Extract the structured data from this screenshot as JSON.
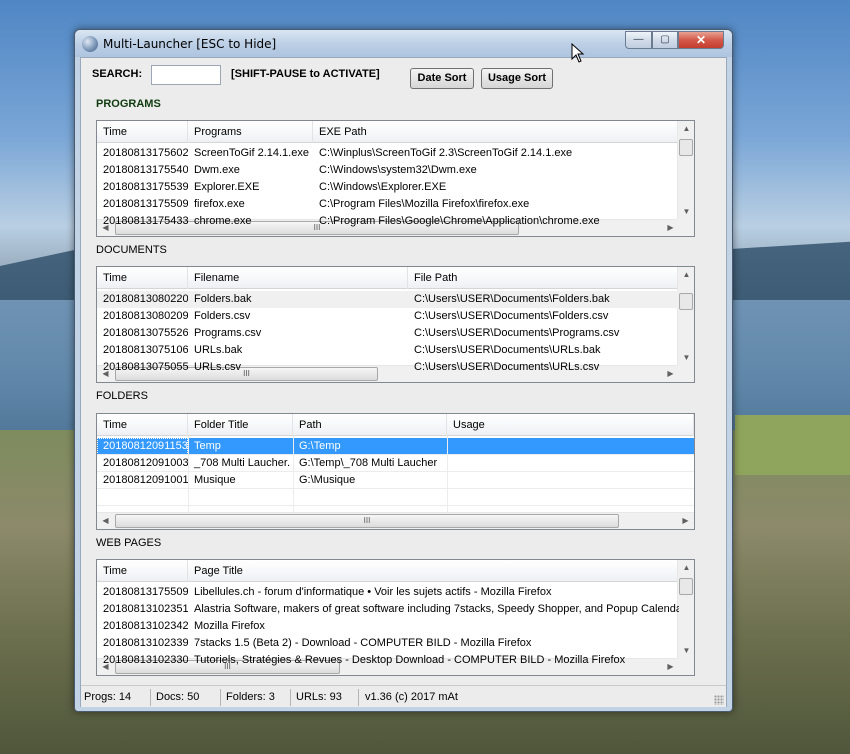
{
  "window": {
    "title": "Multi-Launcher [ESC to Hide]",
    "controls": {
      "minimize": "—",
      "maximize": "▢",
      "close": "✕"
    }
  },
  "toolbar": {
    "search_label": "SEARCH:",
    "search_value": "",
    "hint": "[SHIFT-PAUSE to ACTIVATE]",
    "date_sort": "Date Sort",
    "usage_sort": "Usage Sort"
  },
  "programs": {
    "label": "PROGRAMS",
    "columns": [
      "Time",
      "Programs",
      "EXE Path"
    ],
    "rows": [
      [
        "20180813175602",
        "ScreenToGif 2.14.1.exe",
        "C:\\Winplus\\ScreenToGif 2.3\\ScreenToGif 2.14.1.exe"
      ],
      [
        "20180813175540",
        "Dwm.exe",
        "C:\\Windows\\system32\\Dwm.exe"
      ],
      [
        "20180813175539",
        "Explorer.EXE",
        "C:\\Windows\\Explorer.EXE"
      ],
      [
        "20180813175509",
        "firefox.exe",
        "C:\\Program Files\\Mozilla Firefox\\firefox.exe"
      ],
      [
        "20180813175433",
        "chrome.exe",
        "C:\\Program Files\\Google\\Chrome\\Application\\chrome.exe"
      ]
    ]
  },
  "documents": {
    "label": "DOCUMENTS",
    "columns": [
      "Time",
      "Filename",
      "File Path"
    ],
    "rows": [
      [
        "20180813080220",
        "Folders.bak",
        "C:\\Users\\USER\\Documents\\Folders.bak"
      ],
      [
        "20180813080209",
        "Folders.csv",
        "C:\\Users\\USER\\Documents\\Folders.csv"
      ],
      [
        "20180813075526",
        "Programs.csv",
        "C:\\Users\\USER\\Documents\\Programs.csv"
      ],
      [
        "20180813075106",
        "URLs.bak",
        "C:\\Users\\USER\\Documents\\URLs.bak"
      ],
      [
        "20180813075055",
        "URLs.csv",
        "C:\\Users\\USER\\Documents\\URLs.csv"
      ]
    ]
  },
  "folders": {
    "label": "FOLDERS",
    "columns": [
      "Time",
      "Folder Title",
      "Path",
      "Usage"
    ],
    "rows": [
      [
        "20180812091153",
        "Temp",
        "G:\\Temp",
        ""
      ],
      [
        "20180812091003",
        "_708 Multi Laucher.",
        "G:\\Temp\\_708 Multi Laucher",
        ""
      ],
      [
        "20180812091001",
        "Musique",
        "G:\\Musique",
        ""
      ]
    ]
  },
  "webpages": {
    "label": "WEB PAGES",
    "columns": [
      "Time",
      "Page Title"
    ],
    "rows": [
      [
        "20180813175509",
        "Libellules.ch - forum d'informatique • Voir les sujets actifs - Mozilla Firefox"
      ],
      [
        "20180813102351",
        "Alastria Software, makers of great software including 7stacks, Speedy Shopper, and Popup Calendar ..."
      ],
      [
        "20180813102342",
        "Mozilla Firefox"
      ],
      [
        "20180813102339",
        "7stacks 1.5 (Beta 2) - Download - COMPUTER BILD - Mozilla Firefox"
      ],
      [
        "20180813102330",
        "Tutoriels, Stratégies & Revues - Desktop Download - COMPUTER BILD - Mozilla Firefox"
      ]
    ]
  },
  "status": {
    "progs": "Progs: 14",
    "docs": "Docs: 50",
    "folders": "Folders: 3",
    "urls": "URLs: 93",
    "version": "v1.36 (c) 2017 mAt"
  },
  "scroll_glyphs": {
    "up": "▲",
    "down": "▼",
    "left": "◀",
    "right": "▶",
    "grip": "III"
  }
}
